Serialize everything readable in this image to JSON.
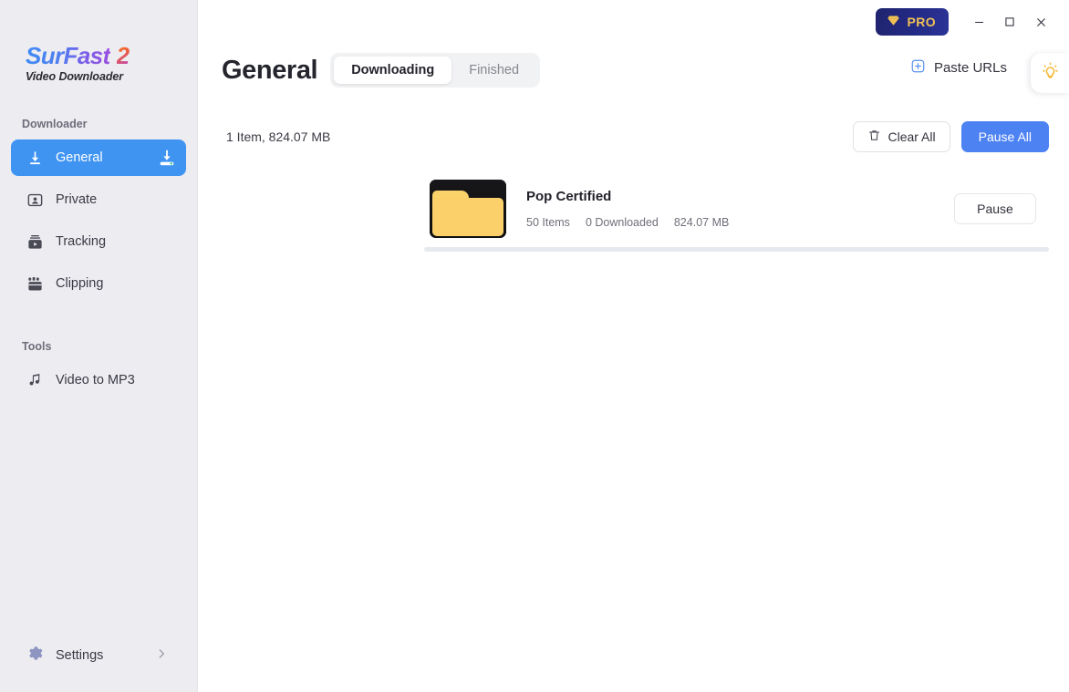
{
  "brand": {
    "name_main": "SurFast",
    "name_version": "2",
    "subtitle": "Video Downloader",
    "accent_blue": "#3f8cf4",
    "accent_purple": "#9b4fe0"
  },
  "sidebar": {
    "section_downloader": "Downloader",
    "section_tools": "Tools",
    "items": [
      {
        "label": "General",
        "icon": "download-arrow-icon",
        "active": true,
        "trailing_icon": "download-tray-icon"
      },
      {
        "label": "Private",
        "icon": "private-person-icon",
        "active": false
      },
      {
        "label": "Tracking",
        "icon": "tracking-video-icon",
        "active": false
      },
      {
        "label": "Clipping",
        "icon": "clipping-film-icon",
        "active": false
      }
    ],
    "tools": [
      {
        "label": "Video to MP3",
        "icon": "music-note-icon"
      }
    ],
    "settings": {
      "label": "Settings",
      "icon": "gear-icon",
      "chevron": "chevron-right-icon"
    }
  },
  "titlebar": {
    "pro_label": "PRO",
    "pro_icon": "diamond-icon",
    "pro_bg": "#232a86",
    "pro_text_color": "#f0c255",
    "minimize_icon": "minimize-icon",
    "maximize_icon": "maximize-icon",
    "close_icon": "close-icon"
  },
  "header": {
    "title": "General",
    "tabs": [
      {
        "label": "Downloading",
        "active": true
      },
      {
        "label": "Finished",
        "active": false
      }
    ],
    "paste_urls_label": "Paste URLs",
    "paste_urls_icon": "plus-square-icon",
    "tip_icon": "lightbulb-icon",
    "tip_color": "#f5b225"
  },
  "toolbar": {
    "summary": "1 Item, 824.07 MB",
    "clear_all_label": "Clear All",
    "clear_all_icon": "trash-icon",
    "pause_all_label": "Pause All",
    "pause_all_color": "#4d82f3"
  },
  "downloads": [
    {
      "title": "Pop Certified",
      "items_count": "50 Items",
      "downloaded_count": "0 Downloaded",
      "size": "824.07 MB",
      "action_label": "Pause",
      "progress_percent": 0,
      "thumbnail_icon": "folder-icon"
    }
  ]
}
